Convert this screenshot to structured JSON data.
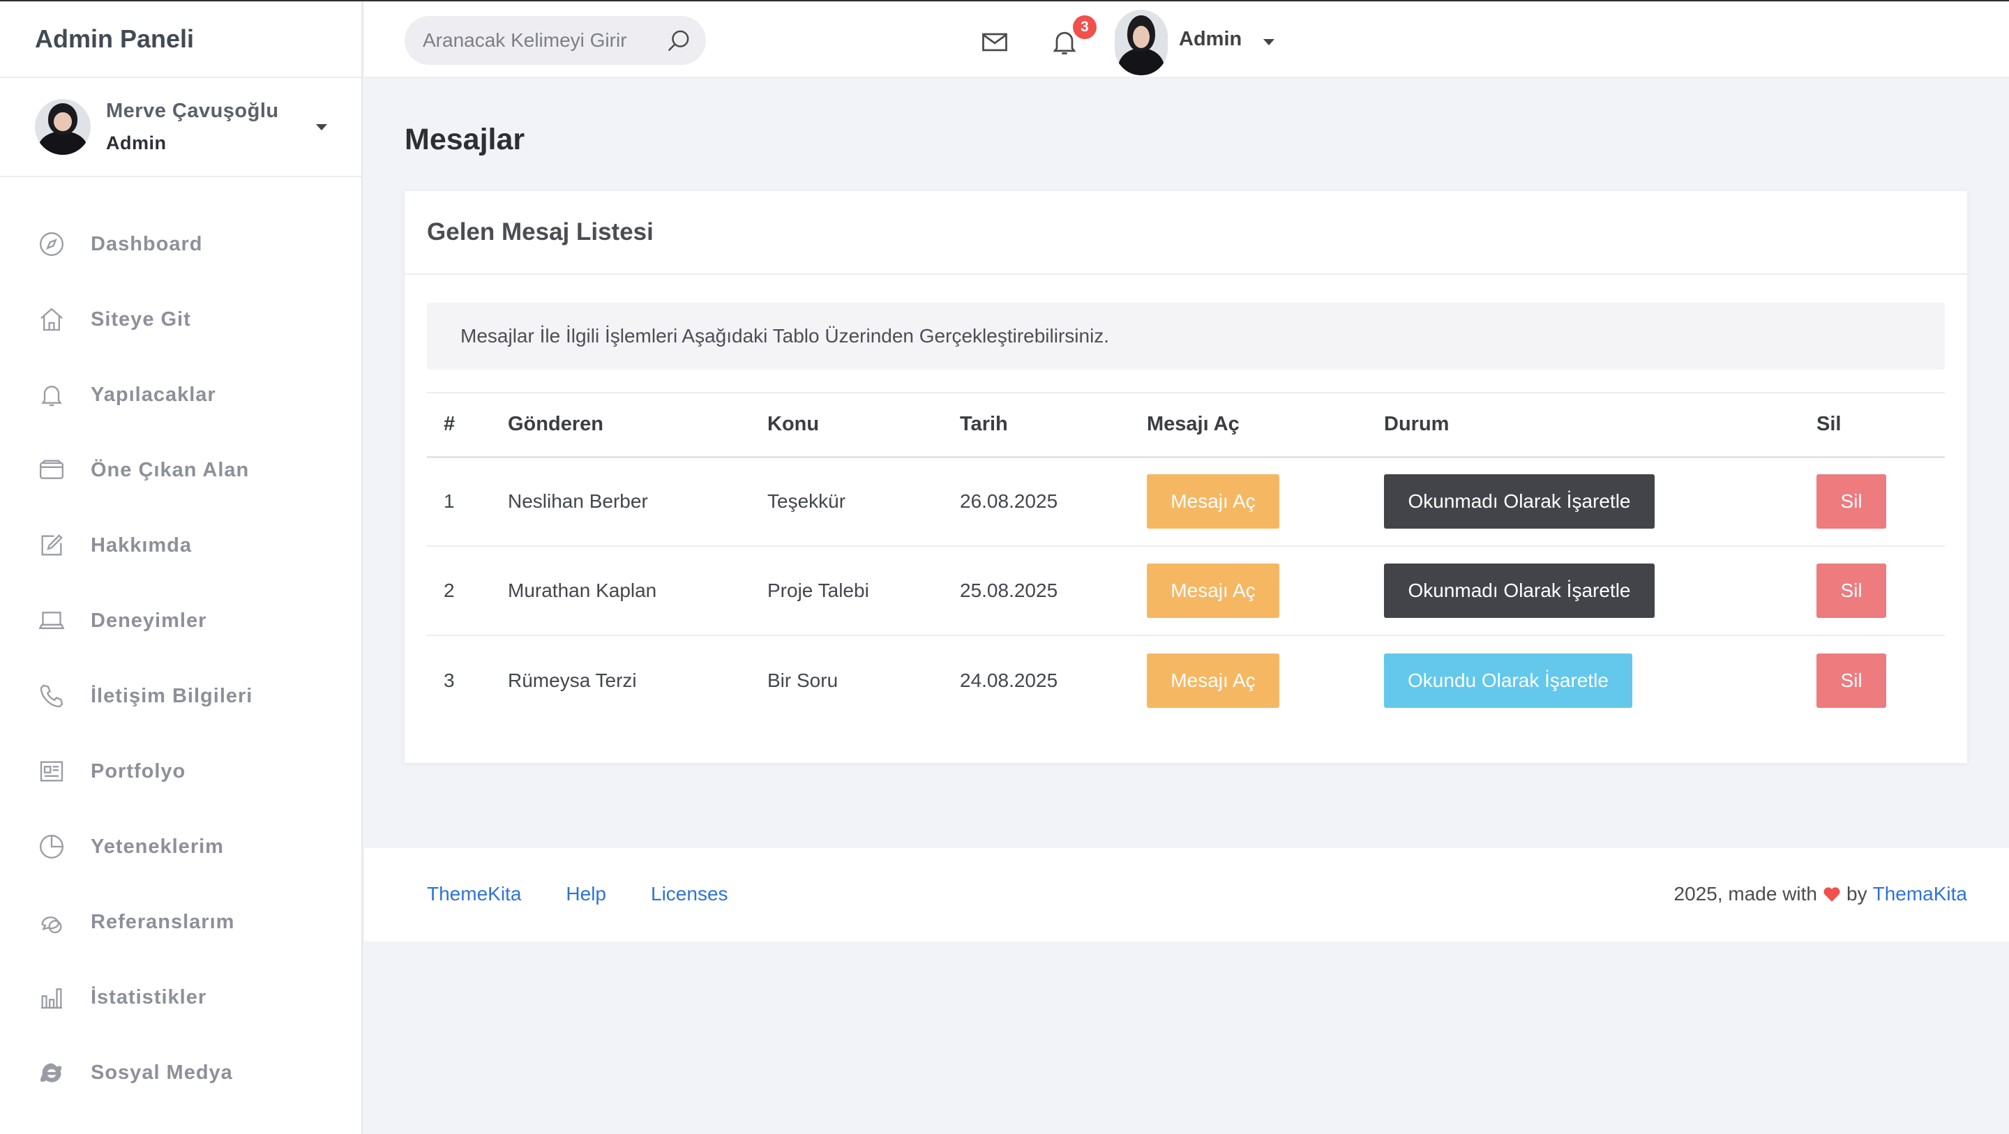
{
  "app": {
    "brand": "Admin Paneli"
  },
  "sidebar": {
    "user": {
      "name": "Merve Çavuşoğlu",
      "role": "Admin"
    },
    "items": [
      {
        "label": "Dashboard",
        "icon": "compass-icon"
      },
      {
        "label": "Siteye Git",
        "icon": "home-icon"
      },
      {
        "label": "Yapılacaklar",
        "icon": "bell-icon"
      },
      {
        "label": "Öne Çıkan Alan",
        "icon": "wallet-icon"
      },
      {
        "label": "Hakkımda",
        "icon": "edit-icon"
      },
      {
        "label": "Deneyimler",
        "icon": "laptop-icon"
      },
      {
        "label": "İletişim Bilgileri",
        "icon": "phone-icon"
      },
      {
        "label": "Portfolyo",
        "icon": "newspaper-icon"
      },
      {
        "label": "Yeteneklerim",
        "icon": "pie-chart-icon"
      },
      {
        "label": "Referanslarım",
        "icon": "chat-icon"
      },
      {
        "label": "İstatistikler",
        "icon": "bar-chart-icon"
      },
      {
        "label": "Sosyal Medya",
        "icon": "globe-icon"
      }
    ]
  },
  "header": {
    "search_placeholder": "Aranacak Kelimeyi Girir",
    "notification_count": "3",
    "user_label": "Admin"
  },
  "main": {
    "page_title": "Mesajlar",
    "card_title": "Gelen Mesaj Listesi",
    "info_text": "Mesajlar İle İlgili İşlemleri Aşağıdaki Tablo Üzerinden Gerçekleştirebilirsiniz.",
    "columns": [
      "#",
      "Gönderen",
      "Konu",
      "Tarih",
      "Mesajı Aç",
      "Durum",
      "Sil"
    ],
    "rows": [
      {
        "no": "1",
        "sender": "Neslihan Berber",
        "subject": "Teşekkür",
        "date": "26.08.2025",
        "open_label": "Mesajı Aç",
        "status_label": "Okunmadı Olarak İşaretle",
        "status_style": "dark",
        "delete_label": "Sil"
      },
      {
        "no": "2",
        "sender": "Murathan Kaplan",
        "subject": "Proje Talebi",
        "date": "25.08.2025",
        "open_label": "Mesajı Aç",
        "status_label": "Okunmadı Olarak İşaretle",
        "status_style": "dark",
        "delete_label": "Sil"
      },
      {
        "no": "3",
        "sender": "Rümeysa Terzi",
        "subject": "Bir Soru",
        "date": "24.08.2025",
        "open_label": "Mesajı Aç",
        "status_label": "Okundu Olarak İşaretle",
        "status_style": "info",
        "delete_label": "Sil"
      }
    ]
  },
  "footer": {
    "links": [
      "ThemeKita",
      "Help",
      "Licenses"
    ],
    "credit_prefix": "2025, made with",
    "credit_by": "by",
    "credit_link": "ThemaKita"
  },
  "colors": {
    "open_button": "#f6b763",
    "status_dark": "#424449",
    "status_info": "#63c8eb",
    "delete_button": "#ee7b7e",
    "badge": "#f2504b",
    "link": "#2f73d6"
  }
}
